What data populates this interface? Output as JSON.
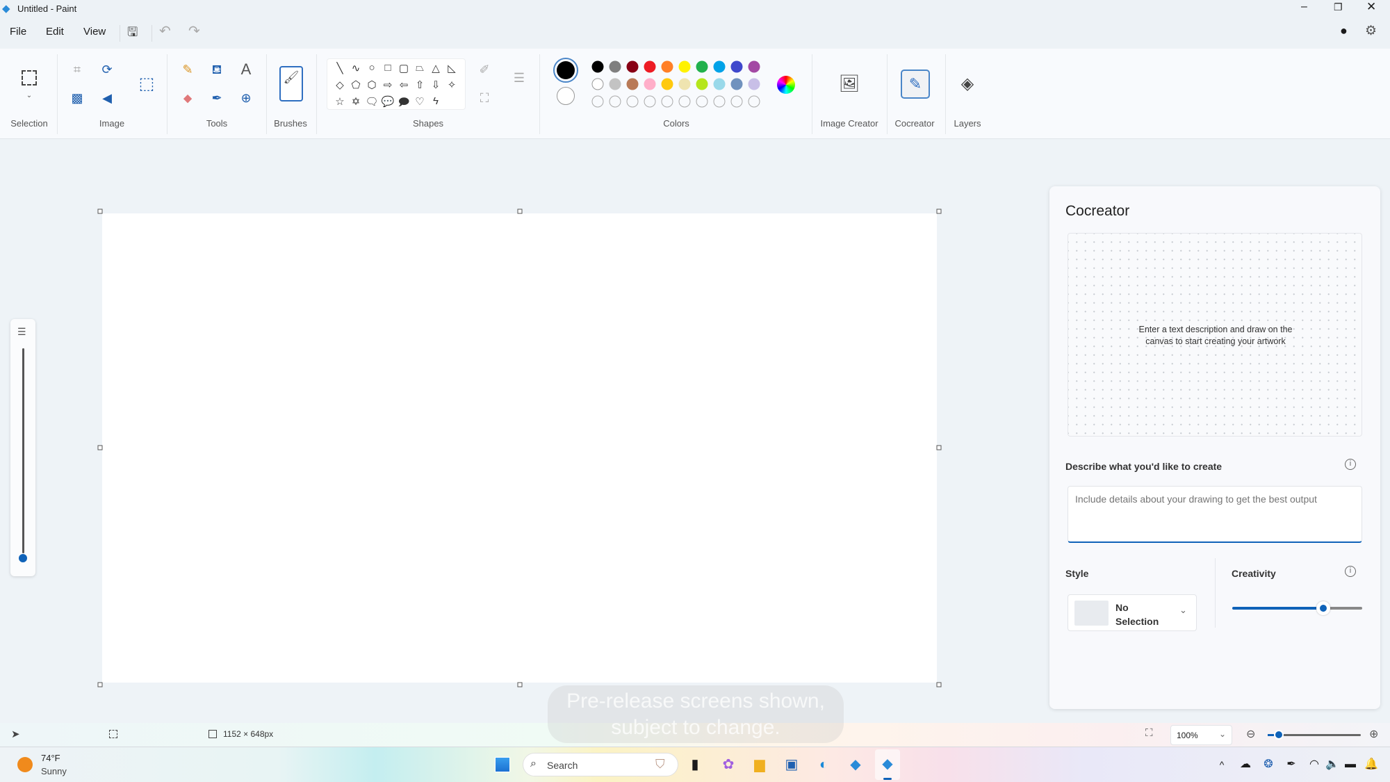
{
  "window": {
    "title": "Untitled - Paint",
    "minimize_icon": "minimize-icon",
    "maximize_icon": "restore-icon",
    "close_icon": "close-icon"
  },
  "menu": {
    "items": [
      "File",
      "Edit",
      "View"
    ]
  },
  "ribbon": {
    "groups": {
      "selection": "Selection",
      "image": "Image",
      "tools": "Tools",
      "brushes": "Brushes",
      "shapes": "Shapes",
      "colors": "Colors",
      "image_creator": "Image Creator",
      "cocreator": "Cocreator",
      "layers": "Layers"
    },
    "shapes": [
      "╲",
      "∿",
      "○",
      "□",
      "▢",
      "⏢",
      "△",
      "◺",
      "◇",
      "⬠",
      "⬡",
      "⇨",
      "⇦",
      "⇧",
      "⇩",
      "✧",
      "☆",
      "✡",
      "🗨",
      "💬",
      "🗩",
      "♡",
      "ϟ"
    ],
    "primary_color": "#000000",
    "secondary_color": "#ffffff",
    "palette": [
      [
        "#000000",
        "#7f7f7f",
        "#880015",
        "#ed1c24",
        "#ff7f27",
        "#fff200",
        "#22b14c",
        "#00a2e8",
        "#3f48cc",
        "#a349a4"
      ],
      [
        "#ffffff",
        "#c3c3c3",
        "#b97a57",
        "#ffaec9",
        "#ffc90e",
        "#efe4b0",
        "#b5e61d",
        "#99d9ea",
        "#7092be",
        "#c8bfe7"
      ],
      [
        "",
        "",
        "",
        "",
        "",
        "",
        "",
        "",
        "",
        ""
      ]
    ],
    "active_tool": "Cocreator"
  },
  "cocreator": {
    "title": "Cocreator",
    "hint": "Enter a text description and draw on the canvas to start creating your artwork",
    "describe_label": "Describe what you'd like to create",
    "prompt_placeholder": "Include details about your drawing to get the best output",
    "prompt_value": "",
    "style_label": "Style",
    "style_value": "No Selection",
    "creativity_label": "Creativity",
    "creativity_level": 0.7,
    "accent": "#0f62b8"
  },
  "status": {
    "canvas_size": "1152 × 648px",
    "zoom": "100%",
    "zoom_level": 0.12
  },
  "watermark": {
    "line1": "Pre-release screens shown,",
    "line2": "subject to change."
  },
  "taskbar": {
    "temperature": "74°F",
    "condition": "Sunny",
    "search_placeholder": "Search"
  }
}
